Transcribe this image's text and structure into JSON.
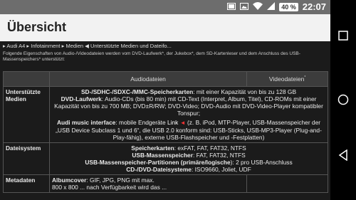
{
  "status": {
    "battery": "40 %",
    "time": "22:07"
  },
  "header": {
    "title": "Übersicht"
  },
  "breadcrumb": {
    "items": [
      "▸ Audi A4",
      "▸ Infotainment",
      "▸ Medien",
      "◀ Unterstützte Medien und Dateifo..."
    ]
  },
  "intro_text": "Folgende Eigenschaften von Audio-/Videodateien werden vom DVD-Laufwerk*, der Jukebox*, dem SD-Kartenleser und dem Anschluss des USB-Massenspeichers* unterstützt:",
  "table": {
    "col_audio": "Audiodateien",
    "col_video": "Videodateien",
    "rows": [
      {
        "label": "Unterstützte Medien",
        "audio_line1_bold": "SD-/SDHC-/SDXC-/MMC-Speicherkarten",
        "audio_line1_rest": ": mit einer Kapazität von bis zu 128 GB",
        "audio_line2_bold": "DVD-Laufwerk",
        "audio_line2_rest": ": Audio-CDs (bis 80 min) mit CD-Text (Interpret, Album, Titel), CD-ROMs mit einer Kapazität von bis zu 700 MB; DVD±R/RW; DVD-Video; DVD-Audio mit DVD-Video-Player kompatibler Tonspur;",
        "audio_line3_bold": "Audi music interface",
        "audio_line3_mid": ": mobile Endgeräte",
        "audio_line3_link": "Link",
        "audio_line3_rest": "(z. B. iPod, MTP-Player, USB-Massenspeicher der „USB Device Subclass 1 und 6“, die USB 2.0 konform sind: USB-Sticks, USB-MP3-Player (Plug-and-Play-fähig), externe USB-Flashspeicher und -Festplatten)"
      },
      {
        "label": "Dateisystem",
        "fs1_bold": "Speicherkarten",
        "fs1_rest": ": exFAT, FAT, FAT32, NTFS",
        "fs2_bold": "USB-Massenspeicher",
        "fs2_rest": ": FAT, FAT32, NTFS",
        "fs3_bold": "USB-Massenspeicher-Partitionen (primäre/logische",
        "fs3_rest": "): 2 pro USB-Anschluss",
        "fs4_bold": "CD-/DVD-Dateisysteme",
        "fs4_rest": ": ISO9660, Joliet, UDF"
      },
      {
        "label": "Metadaten",
        "meta_bold": "Albumcover",
        "meta_rest": ": GIF, JPG, PNG mit max.",
        "meta_line2": "800 x 800 ... nach Verfügbarkeit wird das ..."
      }
    ]
  }
}
